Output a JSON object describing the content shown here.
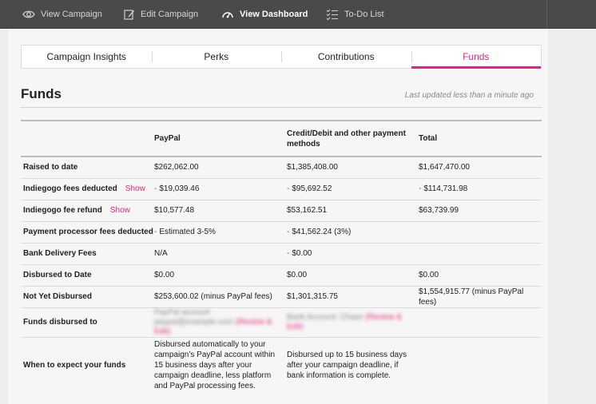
{
  "topnav": {
    "view_campaign": "View Campaign",
    "edit_campaign": "Edit Campaign",
    "view_dashboard": "View Dashboard",
    "todo_list": "To-Do List"
  },
  "tabs": [
    {
      "label": "Campaign Insights"
    },
    {
      "label": "Perks"
    },
    {
      "label": "Contributions"
    },
    {
      "label": "Funds"
    }
  ],
  "page": {
    "title": "Funds",
    "last_updated": "Last updated less than a minute ago",
    "accent_color": "#e6267c"
  },
  "table": {
    "headers": {
      "paypal": "PayPal",
      "credit_line1": "Credit/Debit and other payment",
      "credit_line2": "methods",
      "total": "Total"
    },
    "show_label": "Show",
    "rows": {
      "raised": {
        "label": "Raised to date",
        "paypal": "$262,062.00",
        "credit": "$1,385,408.00",
        "total": "$1,647,470.00"
      },
      "fees": {
        "label": "Indiegogo fees deducted",
        "paypal": "$19,039.46",
        "credit": "$95,692.52",
        "total": "$114,731.98"
      },
      "refund": {
        "label": "Indiegogo fee refund",
        "paypal": "$10,577.48",
        "credit": "$53,162.51",
        "total": "$63,739.99"
      },
      "processor": {
        "label": "Payment processor fees deducted",
        "paypal": "Estimated 3-5%",
        "credit": "$41,562.24 (3%)",
        "total": ""
      },
      "bank": {
        "label": "Bank Delivery Fees",
        "paypal": "N/A",
        "credit": "$0.00",
        "total": ""
      },
      "disbursed": {
        "label": "Disbursed to Date",
        "paypal": "$0.00",
        "credit": "$0.00",
        "total": "$0.00"
      },
      "not_yet": {
        "label": "Not Yet Disbursed",
        "paypal": "$253,600.02 (minus PayPal fees)",
        "credit": "$1,301,315.75",
        "total": "$1,554,915.77 (minus PayPal fees)"
      },
      "disbursed_to": {
        "label": "Funds disbursed to",
        "paypal_l1": "PayPal account",
        "paypal_l2": "paypal@example.com",
        "paypal_link": "(Review & Edit)",
        "credit_l1": "Bank Account: Chase",
        "credit_link": "(Review & Edit)"
      },
      "when": {
        "label": "When to expect your funds",
        "paypal": [
          "Disbursed automatically to your",
          "campaign’s PayPal account within",
          "15 business days after your",
          "campaign deadline, less platform",
          "and PayPal processing fees."
        ],
        "credit": [
          "Disbursed up to 15 business days",
          "after your campaign deadline, if",
          "bank information is complete."
        ]
      }
    }
  }
}
